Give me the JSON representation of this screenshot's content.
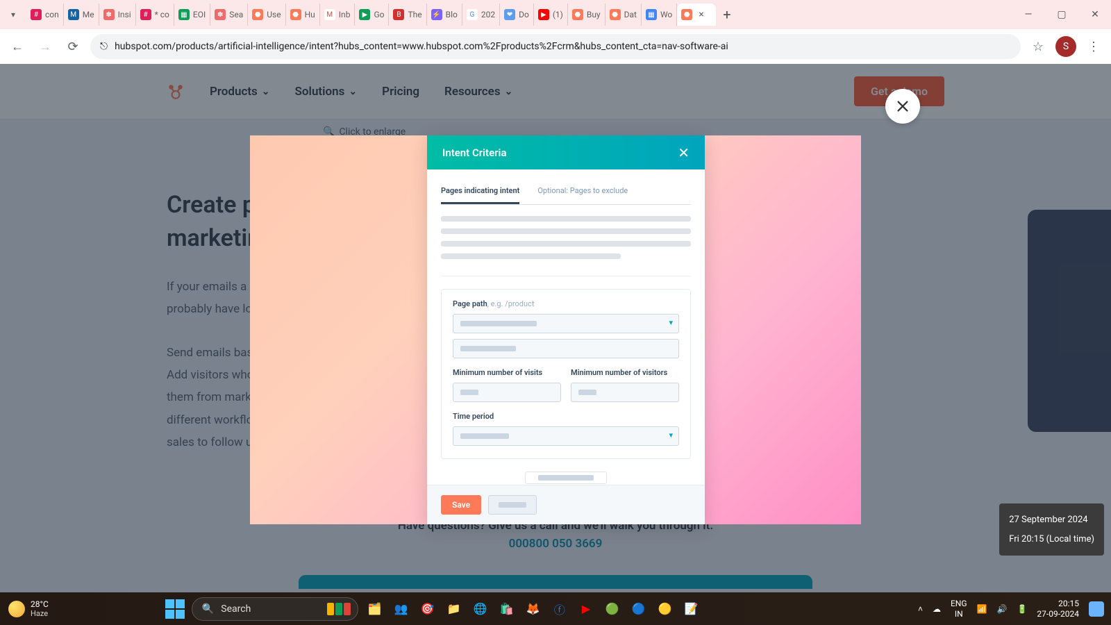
{
  "browser": {
    "dropdown_icon": "▾",
    "tabs": [
      {
        "label": "con",
        "color": "#e01e5a"
      },
      {
        "label": "Me",
        "color": "#1264a3"
      },
      {
        "label": "Insi",
        "color": "#f06a6a"
      },
      {
        "label": "* co",
        "color": "#e01e5a"
      },
      {
        "label": "EOI",
        "color": "#0f9d58"
      },
      {
        "label": "Sea",
        "color": "#f06a6a"
      },
      {
        "label": "Use",
        "color": "#ff7a59"
      },
      {
        "label": "Hu",
        "color": "#ff7a59"
      },
      {
        "label": "Inb",
        "color": "#ea4335"
      },
      {
        "label": "Go",
        "color": "#0f9d58"
      },
      {
        "label": "The",
        "color": "#d32f2f"
      },
      {
        "label": "Blo",
        "color": "#7b61ff"
      },
      {
        "label": "202",
        "color": "#4285f4"
      },
      {
        "label": "Do",
        "color": "#5c9ded"
      },
      {
        "label": "(1)",
        "color": "#ff0000"
      },
      {
        "label": "Buy",
        "color": "#ff7a59"
      },
      {
        "label": "Dat",
        "color": "#ff7a59"
      },
      {
        "label": "Wo",
        "color": "#4285f4"
      }
    ],
    "active_tab": {
      "label": "",
      "close": "×"
    },
    "new_tab": "+",
    "window": {
      "min": "—",
      "max": "▢",
      "close": "✕"
    },
    "nav": {
      "back": "←",
      "forward": "→",
      "reload": "⟳",
      "site": "⎋"
    },
    "url": "hubspot.com/products/artificial-intelligence/intent?hubs_content=www.hubspot.com%2Fproducts%2Fcrm&hubs_content_cta=nav-software-ai",
    "star": "☆",
    "profile": "S",
    "menu": "⋮"
  },
  "page": {
    "nav": {
      "products": "Products",
      "solutions": "Solutions",
      "pricing": "Pricing",
      "resources": "Resources",
      "cta": "Get a demo"
    },
    "enlarge": "Click to enlarge",
    "heading_l1": "Create per",
    "heading_l2": "marketing",
    "para1": "If your emails a\nprobably have lo",
    "para2": "Send emails bas\nAdd visitors who\nthem from mark\ndifferent workflo\nsales to follow u",
    "question": "Have questions? Give us a call and we'll walk you through it.",
    "phone": "000800 050 3669"
  },
  "modal": {
    "title": "Intent Criteria",
    "close": "✕",
    "tabs": {
      "active": "Pages indicating intent",
      "other": "Optional: Pages to exclude"
    },
    "labels": {
      "page_path": "Page path",
      "page_path_eg": ", e.g. /product",
      "min_visits": "Minimum number of visits",
      "min_visitors": "Minimum number of visitors",
      "time_period": "Time period"
    },
    "save": "Save"
  },
  "tooltip": {
    "line1": "27 September 2024",
    "line2": "Fri 20:15 (Local time)"
  },
  "taskbar": {
    "temp": "28°C",
    "cond": "Haze",
    "search": "Search",
    "lang1": "ENG",
    "lang2": "IN",
    "time": "20:15",
    "date": "27-09-2024"
  }
}
